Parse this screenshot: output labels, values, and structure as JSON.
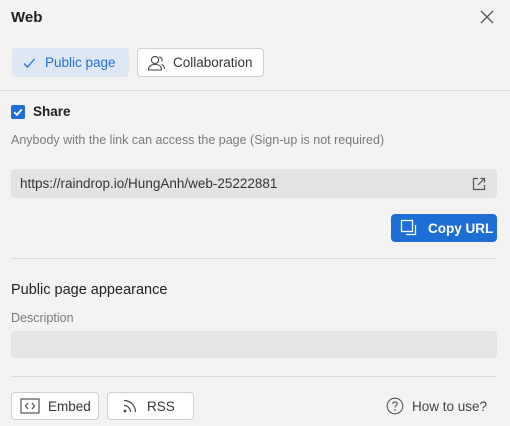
{
  "header": {
    "title": "Web"
  },
  "tabs": [
    {
      "label": "Public page",
      "icon": "check-icon",
      "active": true
    },
    {
      "label": "Collaboration",
      "icon": "users-icon",
      "active": false
    }
  ],
  "share": {
    "label": "Share",
    "checked": true,
    "hint": "Anybody with the link can access the page (Sign-up is not required)",
    "url": "https://raindrop.io/HungAnh/web-25222881",
    "copy_label": "Copy URL"
  },
  "appearance": {
    "title": "Public page appearance",
    "description_label": "Description",
    "description_value": ""
  },
  "footer": {
    "embed_label": "Embed",
    "rss_label": "RSS",
    "help_label": "How to use?"
  },
  "colors": {
    "accent": "#1d6fd6",
    "tab_active_bg": "#dde8f4",
    "background": "#f4f3f1"
  }
}
